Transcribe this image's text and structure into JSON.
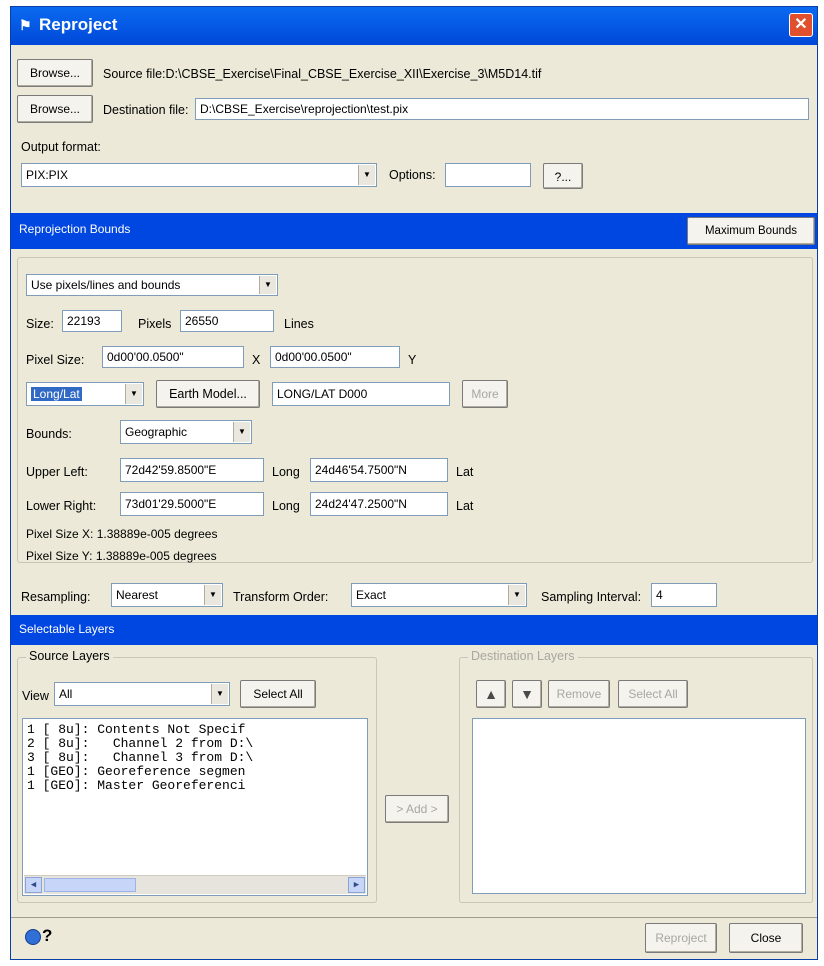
{
  "window": {
    "title": "Reproject",
    "close_glyph": "✕"
  },
  "source": {
    "browse_label": "Browse...",
    "label": "Source file:",
    "path": "D:\\CBSE_Exercise\\Final_CBSE_Exercise_XII\\Exercise_3\\M5D14.tif"
  },
  "destination": {
    "browse_label": "Browse...",
    "label": "Destination file:",
    "path": "D:\\CBSE_Exercise\\reprojection\\test.pix"
  },
  "output": {
    "label": "Output format:",
    "format": "PIX:PIX",
    "options_label": "Options:",
    "options_value": "",
    "help_label": "?..."
  },
  "bounds_section": {
    "title": "Reprojection Bounds",
    "max_bounds_label": "Maximum Bounds"
  },
  "bounds": {
    "mode": "Use pixels/lines and bounds",
    "size_label": "Size:",
    "size_pixels": "22193",
    "pixels_label": "Pixels",
    "size_lines": "26550",
    "lines_label": "Lines",
    "pixel_size_label": "Pixel Size:",
    "pixel_size_x": "0d00'00.0500\"",
    "x_label": "X",
    "pixel_size_y": "0d00'00.0500\"",
    "y_label": "Y",
    "proj": "Long/Lat",
    "earth_model_label": "Earth Model...",
    "proj_string": "LONG/LAT   D000",
    "more_label": "More",
    "bounds_label": "Bounds:",
    "bounds_type": "Geographic",
    "upper_left_label": "Upper Left:",
    "ul_long": "72d42'59.8500\"E",
    "long_label": "Long",
    "ul_lat": "24d46'54.7500\"N",
    "lat_label": "Lat",
    "lower_right_label": "Lower Right:",
    "lr_long": "73d01'29.5000\"E",
    "lr_lat": "24d24'47.2500\"N",
    "pixel_size_x_info": "Pixel Size X:  1.38889e-005 degrees",
    "pixel_size_y_info": "Pixel Size Y:  1.38889e-005 degrees"
  },
  "resampling": {
    "label": "Resampling:",
    "value": "Nearest",
    "transform_label": "Transform Order:",
    "transform_value": "Exact",
    "interval_label": "Sampling Interval:",
    "interval_value": "4"
  },
  "layers_section": {
    "title": "Selectable Layers"
  },
  "source_layers": {
    "title": "Source Layers",
    "view_label": "View",
    "view_value": "All",
    "select_all_label": "Select All",
    "items": [
      "1 [ 8u]: Contents Not Specif",
      "2 [ 8u]:   Channel 2 from D:\\",
      "3 [ 8u]:   Channel 3 from D:\\",
      "1 [GEO]: Georeference segmen",
      "1 [GEO]: Master Georeferenci"
    ]
  },
  "add_label": "> Add >",
  "destination_layers": {
    "title": "Destination Layers",
    "up_glyph": "▲",
    "down_glyph": "▼",
    "remove_label": "Remove",
    "select_all_label": "Select All"
  },
  "footer": {
    "help_glyph": "?",
    "reproject_label": "Reproject",
    "close_label": "Close"
  },
  "colors": {
    "title_bar": "#0a5fe8",
    "section_bar": "#0046e0",
    "dialog_bg": "#ece9d8"
  }
}
